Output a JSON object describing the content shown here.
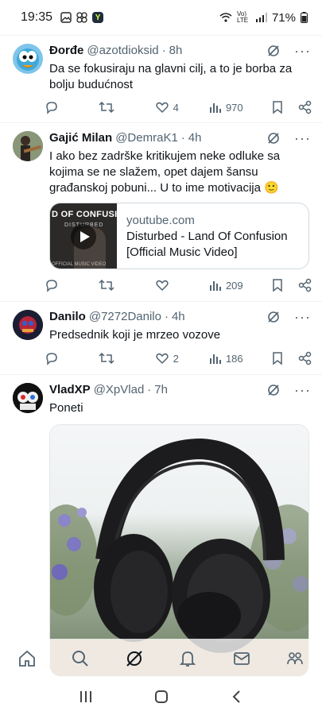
{
  "status_bar": {
    "time": "19:35",
    "network": "Vo) LTE",
    "battery": "71%"
  },
  "posts": [
    {
      "name": "Đorđe",
      "handle": "@azotdioksid",
      "age": "8h",
      "text": "Da se fokusiraju na glavni cilj, a to je borba za bolju budućnost",
      "likes": "4",
      "views": "970"
    },
    {
      "name": "Gajić Milan",
      "handle": "@DemraK1",
      "age": "4h",
      "text": "I ako bez zadrške kritikujem neke odluke sa kojima se ne slažem, opet dajem šansu građanskoj pobuni... U to ime motivacija 🙂",
      "link": {
        "domain": "youtube.com",
        "title": "Disturbed - Land Of Confusion [Official Music Video]",
        "thumb_title": "D OF CONFUSI",
        "thumb_band": "DISTURBED",
        "thumb_caption": "OFFICIAL MUSIC VIDEO"
      },
      "likes": "",
      "views": "209"
    },
    {
      "name": "Danilo",
      "handle": "@7272Danilo",
      "age": "4h",
      "text": "Predsednik koji je mrzeo vozove",
      "likes": "2",
      "views": "186"
    },
    {
      "name": "VladXP",
      "handle": "@XpVlad",
      "age": "7h",
      "text": "Poneti"
    }
  ],
  "bottom_nav": [
    "home-icon",
    "search-icon",
    "grok-icon",
    "notifications-icon",
    "messages-icon",
    "communities-icon"
  ],
  "colors": {
    "text": "#0f1419",
    "secondary": "#536471",
    "divider": "#eff3f4"
  }
}
